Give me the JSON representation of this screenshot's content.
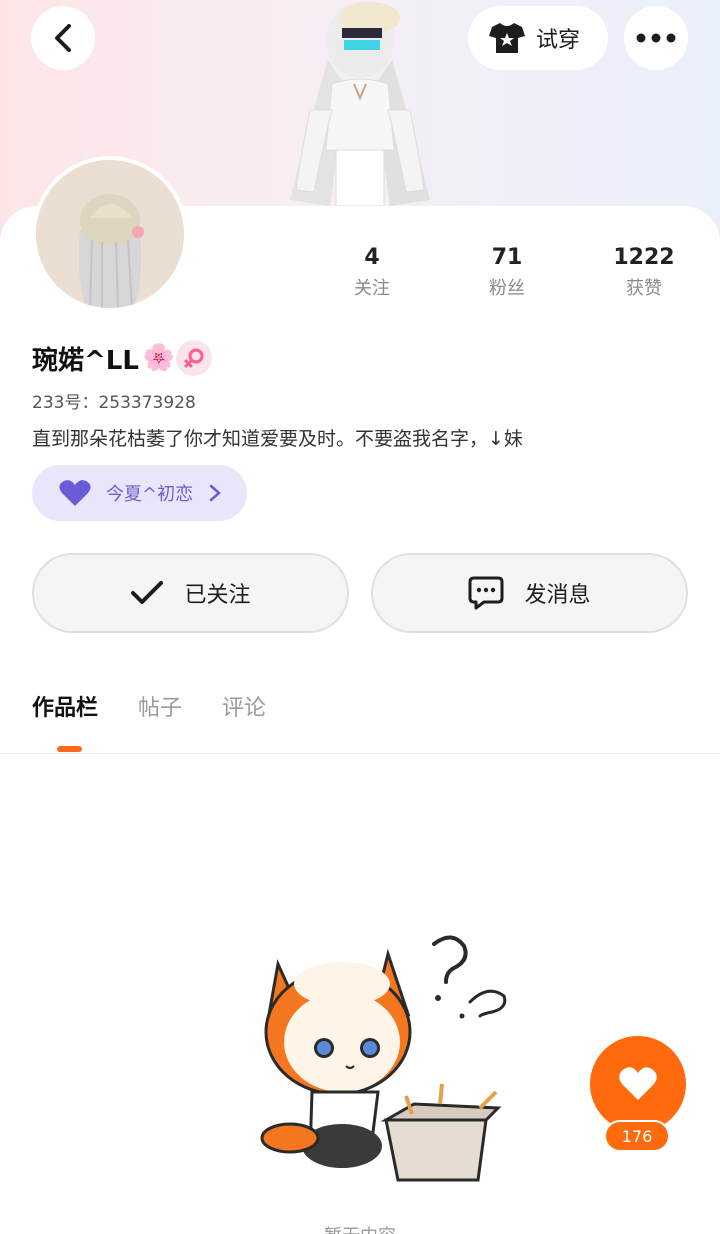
{
  "header": {
    "try_on_label": "试穿"
  },
  "profile": {
    "name": "琬婼^LL",
    "name_emoji": "🌸",
    "id_text": "233号：253373928",
    "bio": "直到那朵花枯萎了你才知道爱要及时。不要盗我名字，↓妹",
    "cp_label": "今夏^初恋"
  },
  "stats": [
    {
      "value": "4",
      "label": "关注"
    },
    {
      "value": "71",
      "label": "粉丝"
    },
    {
      "value": "1222",
      "label": "获赞"
    }
  ],
  "actions": {
    "followed_label": "已关注",
    "message_label": "发消息"
  },
  "tabs": [
    {
      "label": "作品栏",
      "active": true
    },
    {
      "label": "帖子",
      "active": false
    },
    {
      "label": "评论",
      "active": false
    }
  ],
  "empty": {
    "text": "暂无内容"
  },
  "like": {
    "count": "176"
  },
  "colors": {
    "accent": "#ff6a0d",
    "cp_bg": "#e9e6fb",
    "cp_text": "#6d5fd1",
    "gender_bg": "#fbe3ea"
  },
  "icons": [
    "back-icon",
    "tshirt-star-icon",
    "more-icon",
    "female-icon",
    "heart-icon",
    "chevron-right-icon",
    "check-icon",
    "chat-bubble-icon",
    "like-heart-icon"
  ]
}
